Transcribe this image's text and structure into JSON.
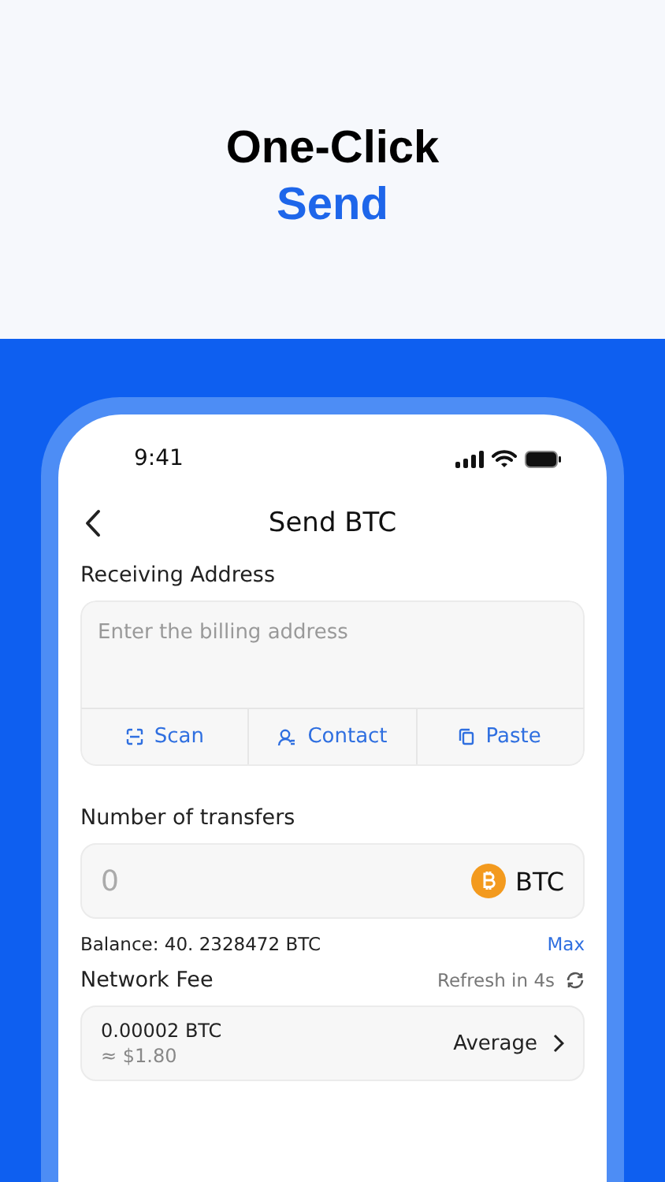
{
  "headline": {
    "line_1": "One-Click",
    "line_2": "Send"
  },
  "status_bar": {
    "time": "9:41"
  },
  "nav": {
    "title": "Send BTC"
  },
  "receiving": {
    "label": "Receiving Address",
    "placeholder": "Enter the billing address",
    "actions": [
      {
        "kind": "scan",
        "label": "Scan"
      },
      {
        "kind": "contact",
        "label": "Contact"
      },
      {
        "kind": "paste",
        "label": "Paste"
      }
    ]
  },
  "amount": {
    "label": "Number of transfers",
    "placeholder": "0",
    "currency": "BTC",
    "balance": "Balance: 40. 2328472 BTC",
    "max": "Max"
  },
  "fee": {
    "label": "Network Fee",
    "refresh": "Refresh in 4s",
    "amount": "0.00002 BTC",
    "fiat": "≈ $1.80",
    "speed": "Average"
  }
}
